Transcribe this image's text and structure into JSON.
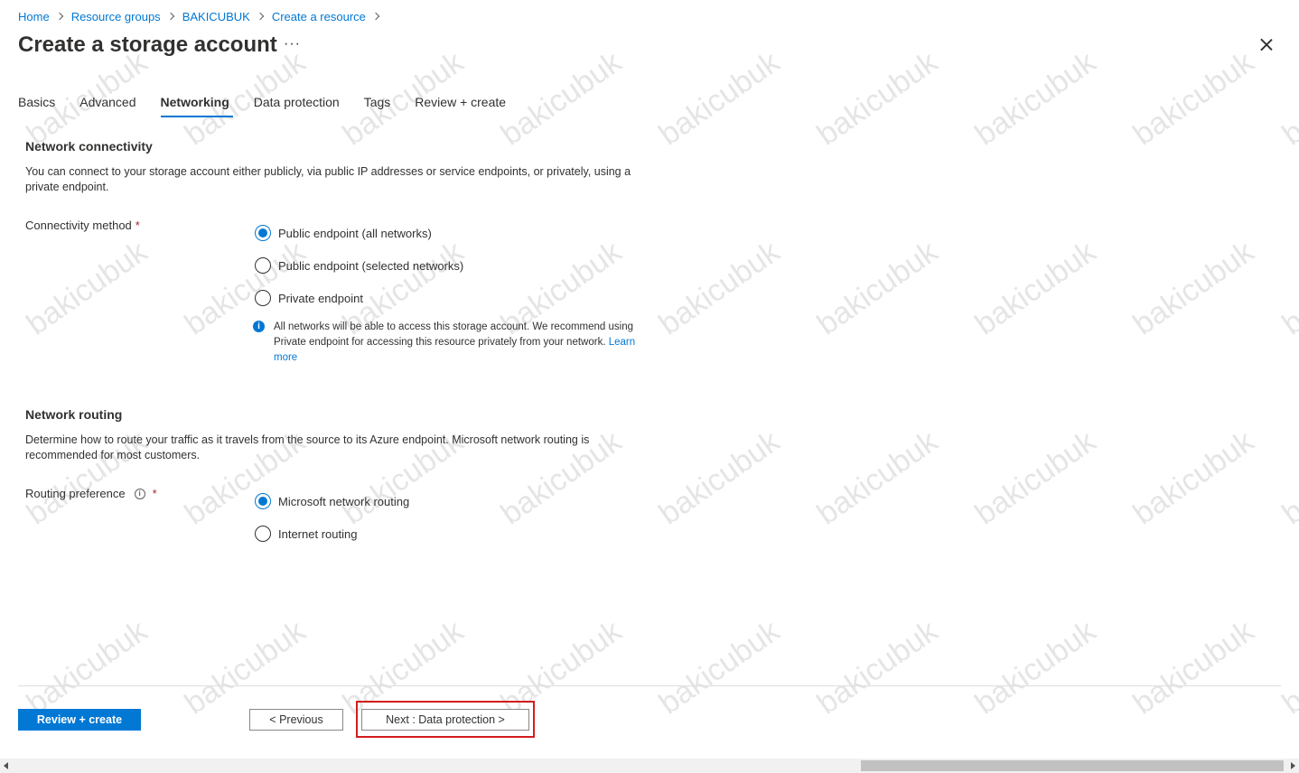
{
  "breadcrumb": [
    "Home",
    "Resource groups",
    "BAKICUBUK",
    "Create a resource"
  ],
  "page_title": "Create a storage account",
  "more_label": "···",
  "tabs": [
    {
      "label": "Basics"
    },
    {
      "label": "Advanced"
    },
    {
      "label": "Networking",
      "active": true
    },
    {
      "label": "Data protection"
    },
    {
      "label": "Tags"
    },
    {
      "label": "Review + create"
    }
  ],
  "network_connectivity": {
    "title": "Network connectivity",
    "description": "You can connect to your storage account either publicly, via public IP addresses or service endpoints, or privately, using a private endpoint.",
    "field_label": "Connectivity method",
    "required_mark": "*",
    "options": [
      {
        "label": "Public endpoint (all networks)",
        "checked": true
      },
      {
        "label": "Public endpoint (selected networks)",
        "checked": false
      },
      {
        "label": "Private endpoint",
        "checked": false
      }
    ],
    "info_text": "All networks will be able to access this storage account. We recommend using Private endpoint for accessing this resource privately from your network.",
    "learn_more": "Learn more"
  },
  "network_routing": {
    "title": "Network routing",
    "description": "Determine how to route your traffic as it travels from the source to its Azure endpoint. Microsoft network routing is recommended for most customers.",
    "field_label": "Routing preference",
    "required_mark": "*",
    "options": [
      {
        "label": "Microsoft network routing",
        "checked": true
      },
      {
        "label": "Internet routing",
        "checked": false
      }
    ]
  },
  "footer": {
    "review_create": "Review + create",
    "previous": "< Previous",
    "next": "Next : Data protection >"
  },
  "watermark": "bakicubuk",
  "colors": {
    "accent": "#0078d4",
    "required": "#a4262c",
    "highlight": "#d31d1d"
  }
}
